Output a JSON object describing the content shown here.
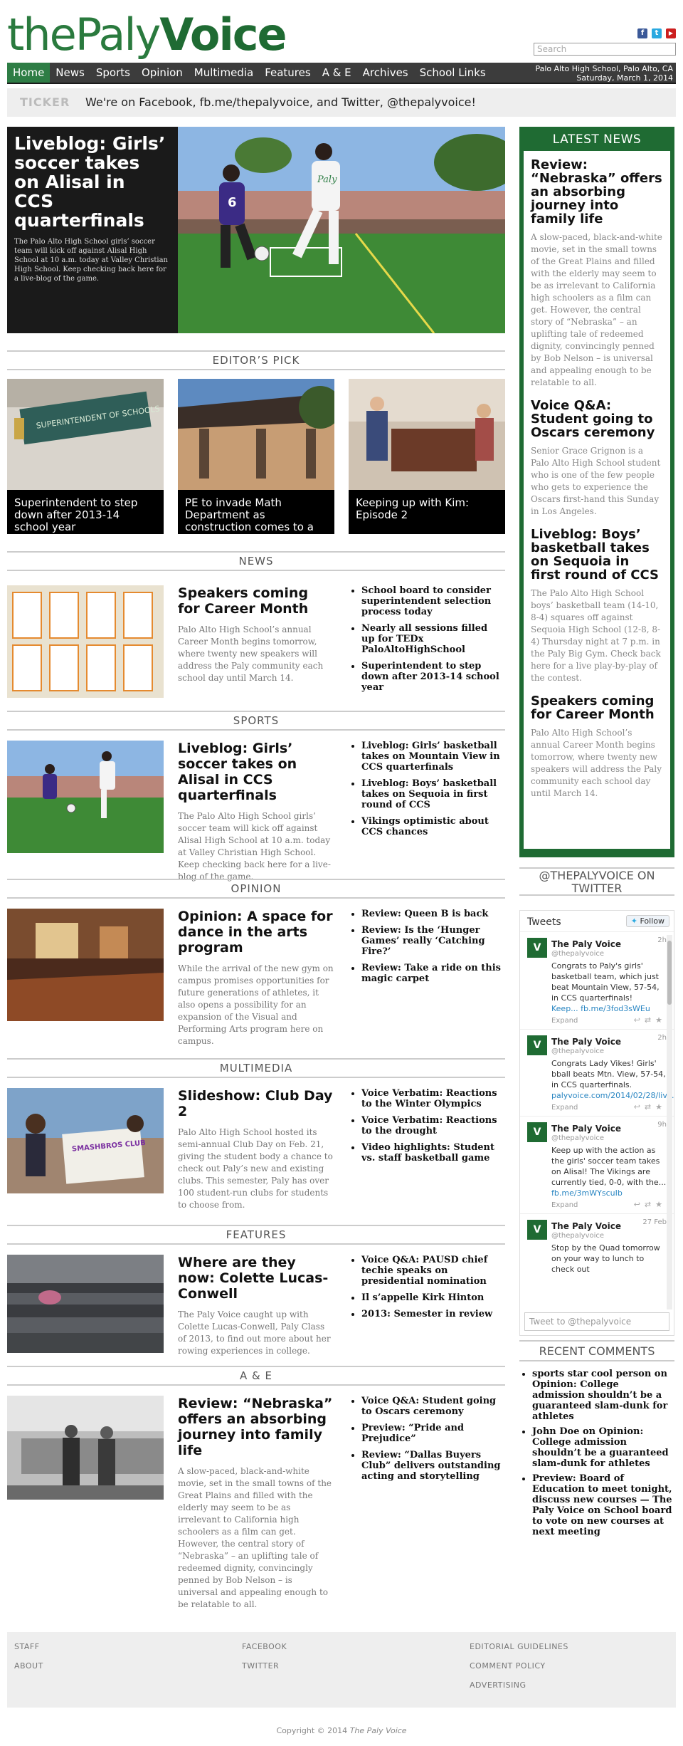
{
  "masthead": {
    "logo_thin": "thePaly",
    "logo_bold": "Voice",
    "search_placeholder": "Search",
    "social": [
      "facebook-icon",
      "twitter-icon",
      "youtube-icon"
    ]
  },
  "nav": {
    "items": [
      "Home",
      "News",
      "Sports",
      "Opinion",
      "Multimedia",
      "Features",
      "A & E",
      "Archives",
      "School Links"
    ],
    "location": "Palo Alto High School, Palo Alto, CA",
    "date": "Saturday, March 1, 2014"
  },
  "ticker": {
    "label": "TICKER",
    "text": "We're on Facebook, fb.me/thepalyvoice, and Twitter, @thepalyvoice!"
  },
  "hero": {
    "title": "Liveblog: Girls’ soccer takes on Alisal in CCS quarterfinals",
    "summary": "The Palo Alto High School girls’ soccer team will kick off against Alisal High School at 10 a.m. today at Valley Christian High School. Keep checking back here for a live-blog of the game."
  },
  "editors_pick": {
    "heading": "EDITOR’S PICK",
    "items": [
      {
        "caption": "Superintendent to step down after 2013-14 school year",
        "sign": "SUPERINTENDENT OF SCHOOLS"
      },
      {
        "caption": "PE to invade Math Department as construction comes to a"
      },
      {
        "caption": "Keeping up with Kim: Episode 2"
      }
    ]
  },
  "sections": {
    "news": {
      "heading": "NEWS",
      "title": "Speakers coming for Career Month",
      "summary": "Palo Alto High School’s annual Career Month begins tomorrow, where twenty new speakers will address the Paly community each school day until March 14.",
      "links": [
        "School board to consider superintendent selection process today",
        "Nearly all sessions filled up for TEDx PaloAltoHighSchool",
        "Superintendent to step down after 2013-14 school year"
      ]
    },
    "sports": {
      "heading": "SPORTS",
      "title": "Liveblog: Girls’ soccer takes on Alisal in CCS quarterfinals",
      "summary": "The Palo Alto High School girls’ soccer team will kick off against Alisal High School at 10 a.m. today at Valley Christian High School. Keep checking back here for a live-blog of the game.",
      "links": [
        "Liveblog: Girls’ basketball takes on Mountain View in CCS quarterfinals",
        "Liveblog: Boys’ basketball takes on Sequoia in first round of CCS",
        "Vikings optimistic about CCS chances"
      ]
    },
    "opinion": {
      "heading": "OPINION",
      "title": "Opinion: A space for dance in the arts program",
      "summary": "While the arrival of the new gym on campus promises opportunities for future generations of athletes, it also opens a possibility for an expansion of the Visual and Performing Arts program here on campus.",
      "links": [
        "Review: Queen B is back",
        "Review: Is the ‘Hunger Games’ really ‘Catching Fire?’",
        "Review: Take a ride on this magic carpet"
      ]
    },
    "multimedia": {
      "heading": "MULTIMEDIA",
      "title": "Slideshow: Club Day 2",
      "summary": "Palo Alto High School hosted its semi-annual Club Day on Feb. 21, giving the student body a chance to check out Paly’s new and existing clubs. This semester, Paly has over 100 student-run clubs for students to choose from.",
      "links": [
        "Voice Verbatim: Reactions to the Winter Olympics",
        "Voice Verbatim: Reactions to the drought",
        "Video highlights: Student vs. staff basketball game"
      ],
      "sign": "SMASHBROS CLUB"
    },
    "features": {
      "heading": "FEATURES",
      "title": "Where are they now: Colette Lucas-Conwell",
      "summary": "The Paly Voice caught up with Colette Lucas-Conwell, Paly Class of 2013, to find out more about her rowing experiences in college.",
      "links": [
        "Voice Q&A: PAUSD chief techie speaks on presidential nomination",
        "Il s’appelle Kirk Hinton",
        "2013: Semester in review"
      ]
    },
    "ae": {
      "heading": "A & E",
      "title": "Review: “Nebraska” offers an absorbing journey into family life",
      "summary": "A slow-paced, black-and-white movie, set in the small towns of the Great Plains and filled with the elderly may seem to be as irrelevant to California high schoolers as a film can get. However, the central story of “Nebraska” – an uplifting tale of redeemed dignity, convincingly penned by Bob Nelson – is universal and appealing enough to be relatable to all.",
      "links": [
        "Voice Q&A: Student going to Oscars ceremony",
        "Preview: “Pride and Prejudice”",
        "Review: “Dallas Buyers Club” delivers outstanding acting and storytelling"
      ]
    }
  },
  "latest_news": {
    "heading": "LATEST NEWS",
    "items": [
      {
        "title": "Review: “Nebraska” offers an absorbing journey into family life",
        "summary": "A slow-paced, black-and-white movie, set in the small towns of the Great Plains and filled with the elderly may seem to be as irrelevant to California high schoolers as a film can get. However, the central story of “Nebraska” – an uplifting tale of redeemed dignity, convincingly penned by Bob Nelson – is universal and appealing enough to be relatable to all."
      },
      {
        "title": "Voice Q&A: Student going to Oscars ceremony",
        "summary": "Senior Grace Grignon is a Palo Alto High School student who is one of the few people who gets to experience the Oscars first-hand this Sunday in Los Angeles."
      },
      {
        "title": "Liveblog: Boys’ basketball takes on Sequoia in first round of CCS",
        "summary": "The Palo Alto High School boys’ basketball team (14-10, 8-4) squares off against Sequoia High School (12-8, 8-4) Thursday night at 7 p.m. in the Paly Big Gym. Check back here for a live play-by-play of the contest."
      },
      {
        "title": "Speakers coming for Career Month",
        "summary": "Palo Alto High School’s annual Career Month begins tomorrow, where twenty new speakers will address the Paly community each school day until March 14."
      }
    ]
  },
  "twitter": {
    "heading": "@THEPALYVOICE ON TWITTER",
    "widget_title": "Tweets",
    "follow": "Follow",
    "compose_placeholder": "Tweet to @thepalyvoice",
    "tweets": [
      {
        "name": "The Paly Voice",
        "handle": "@thepalyvoice",
        "time": "2h",
        "body": "Congrats to Paly's girls' basketball team, which just beat Mountain View, 57-54, in CCS quarterfinals!",
        "link": "Keep... fb.me/3fod3sWEu",
        "expand": "Expand"
      },
      {
        "name": "The Paly Voice",
        "handle": "@thepalyvoice",
        "time": "2h",
        "body": "Congrats Lady Vikes! Girls' bball beats Mtn. View, 57-54, in CCS quarterfinals.",
        "link": "palyvoice.com/2014/02/28/liv...",
        "expand": "Expand"
      },
      {
        "name": "The Paly Voice",
        "handle": "@thepalyvoice",
        "time": "9h",
        "body": "Keep up with the action as the girls' soccer team takes on Alisal! The Vikings are currently tied, 0-0, with the...",
        "link": "fb.me/3mWYscuIb",
        "expand": "Expand"
      },
      {
        "name": "The Paly Voice",
        "handle": "@thepalyvoice",
        "time": "27 Feb",
        "body": "Stop by the Quad tomorrow on your way to lunch to check out",
        "link": "",
        "expand": ""
      }
    ]
  },
  "recent_comments": {
    "heading": "RECENT COMMENTS",
    "items": [
      "sports star cool person on Opinion: College admission shouldn’t be a guaranteed slam-dunk for athletes",
      "John Doe on Opinion: College admission shouldn’t be a guaranteed slam-dunk for athletes",
      "Preview: Board of Education to meet tonight, discuss new courses — The Paly Voice on School board to vote on new courses at next meeting"
    ]
  },
  "footer": {
    "col1": [
      "STAFF",
      "ABOUT"
    ],
    "col2": [
      "FACEBOOK",
      "TWITTER"
    ],
    "col3": [
      "EDITORIAL GUIDELINES",
      "COMMENT POLICY",
      "ADVERTISING"
    ],
    "copyright_prefix": "Copyright © 2014",
    "copyright_name": "The Paly Voice"
  },
  "colors": {
    "brand_green": "#1f6b33",
    "nav_bg": "#3c3c3c",
    "active_nav": "#2e7d45",
    "link_blue": "#2a86c2"
  }
}
